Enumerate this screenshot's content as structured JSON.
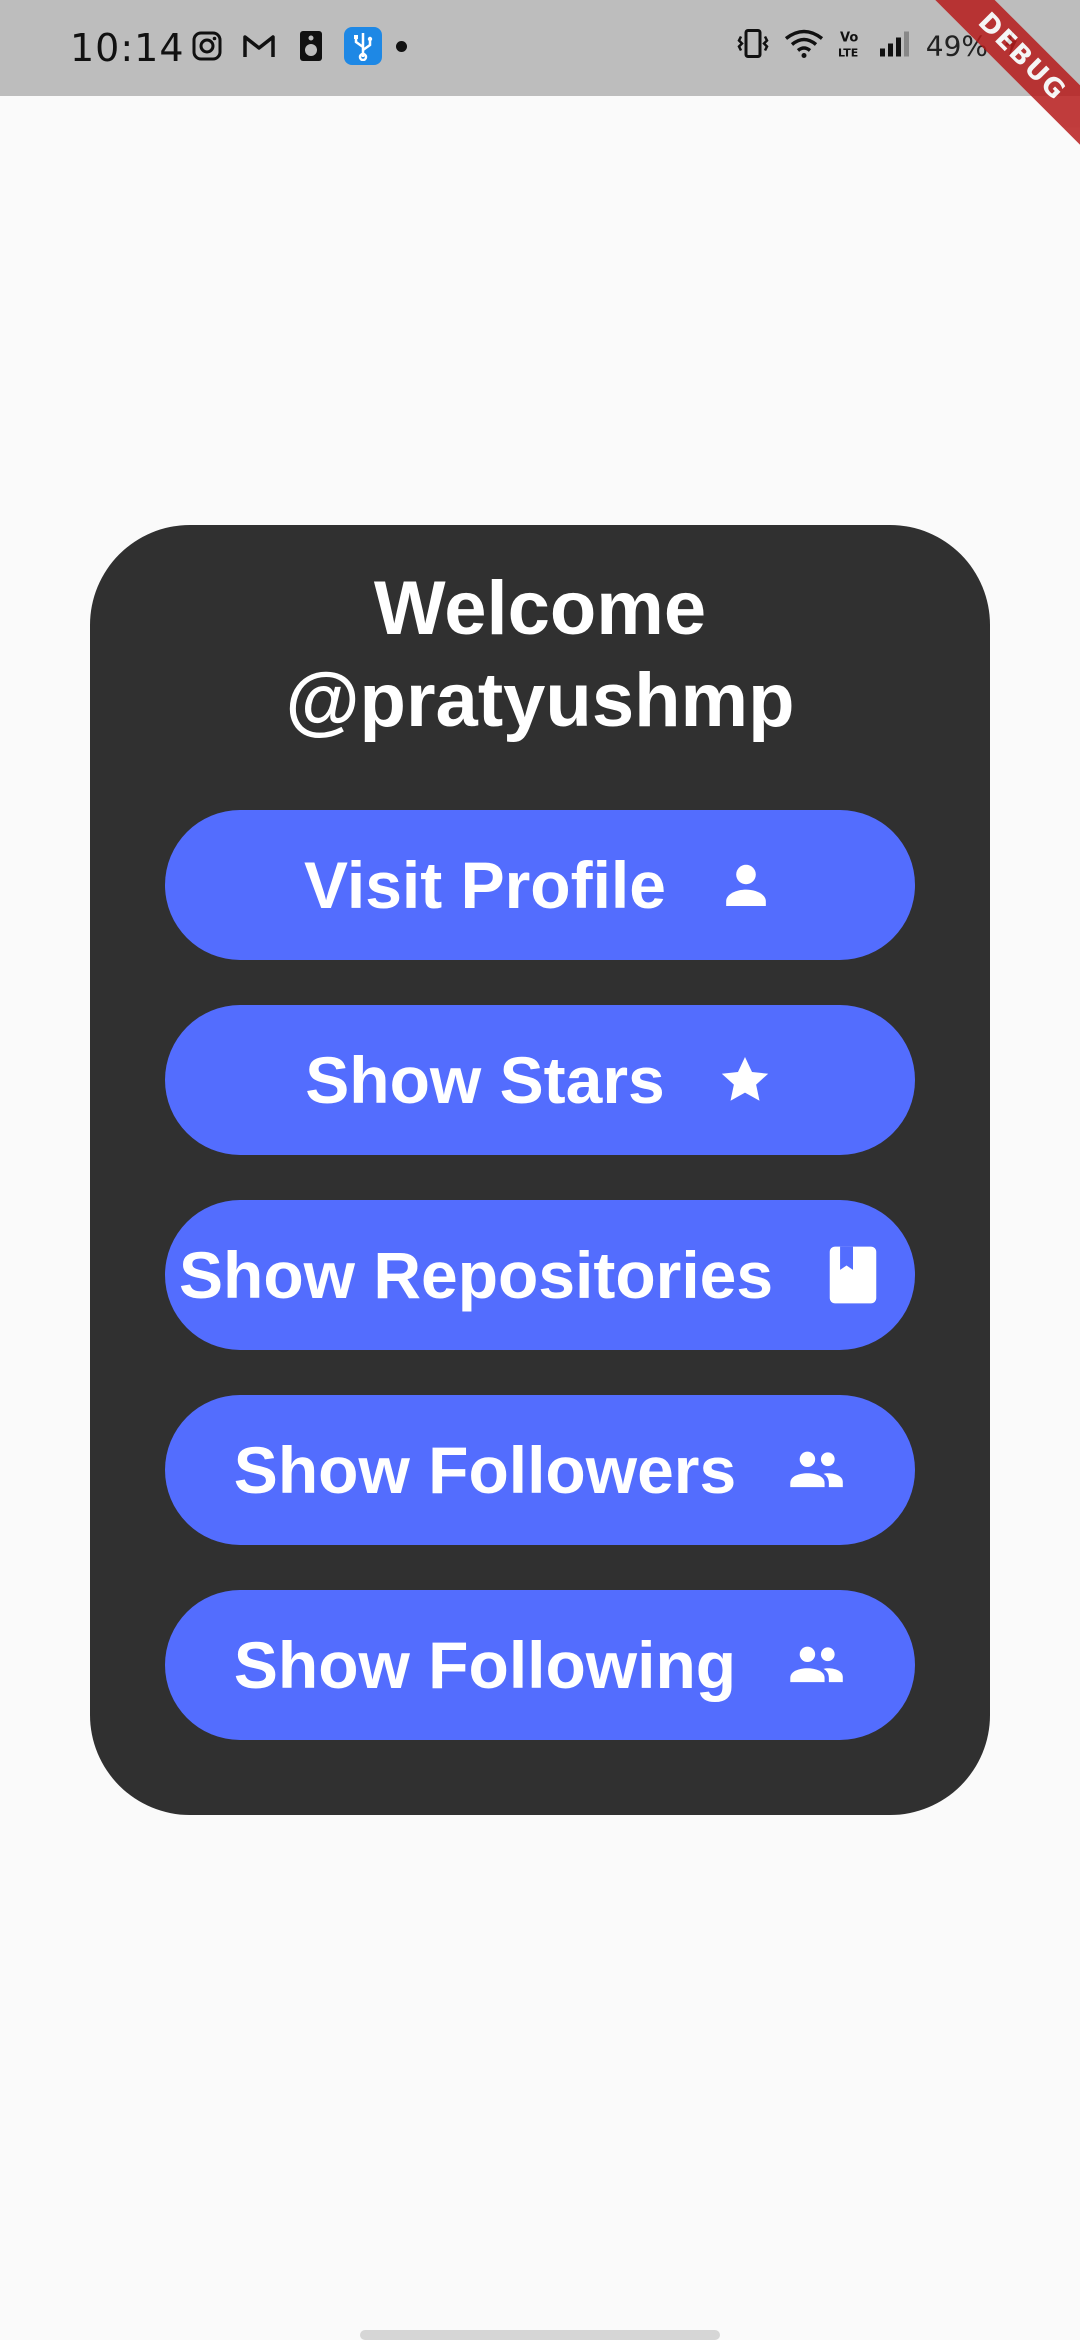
{
  "status_bar": {
    "time": "10:14",
    "battery": "49%",
    "left_icons": [
      "instagram-icon",
      "gmail-icon",
      "speaker-icon",
      "usb-icon",
      "notification-dot"
    ],
    "right_icons": [
      "vibrate-icon",
      "wifi-icon",
      "volte-icon",
      "signal-icon",
      "battery-charging-icon"
    ],
    "debug_banner": "DEBUG"
  },
  "card": {
    "title_line1": "Welcome",
    "title_line2": "@pratyushmp",
    "buttons": [
      {
        "label": "Visit Profile",
        "icon": "person-icon"
      },
      {
        "label": "Show Stars",
        "icon": "star-icon"
      },
      {
        "label": "Show Repositories",
        "icon": "book-icon"
      },
      {
        "label": "Show Followers",
        "icon": "people-icon"
      },
      {
        "label": "Show Following",
        "icon": "people-icon"
      }
    ]
  },
  "colors": {
    "background": "#fafafa",
    "status_bar": "#bdbdbd",
    "card": "#303030",
    "button": "#536dfe",
    "text": "#ffffff",
    "debug_ribbon": "#b71c1c"
  }
}
